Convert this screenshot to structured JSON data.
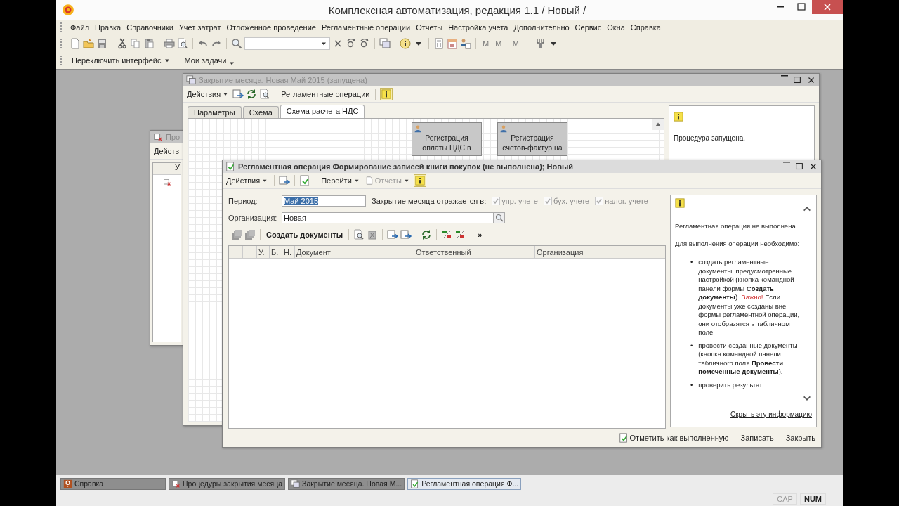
{
  "window": {
    "title": "Комплексная автоматизация, редакция 1.1 / Новый /"
  },
  "menu": [
    "Файл",
    "Правка",
    "Справочники",
    "Учет затрат",
    "Отложенное проведение",
    "Регламентные операции",
    "Отчеты",
    "Настройка учета",
    "Дополнительно",
    "Сервис",
    "Окна",
    "Справка"
  ],
  "toolbar": {
    "memory_buttons": [
      "M",
      "M+",
      "M−"
    ]
  },
  "panel_bar": [
    "Переключить интерфейс",
    "Мои задачи"
  ],
  "procedures_window": {
    "title": "Про",
    "toolbar": "Действ",
    "column": "У"
  },
  "month_close_window": {
    "title": "Закрытие месяца. Новая Май 2015 (запущена)",
    "active": false,
    "toolbar": [
      "Действия",
      "Регламентные операции"
    ],
    "tabs": [
      {
        "label": "Параметры",
        "selected": false
      },
      {
        "label": "Схема",
        "selected": false
      },
      {
        "label": "Схема расчета НДС",
        "selected": true
      }
    ],
    "nodes": [
      "Регистрация оплаты НДС в",
      "Регистрация счетов-фактур на"
    ],
    "info": "Процедура запущена."
  },
  "operation_window": {
    "title": "Регламентная операция Формирование записей книги покупок (не выполнена); Новый",
    "active": true,
    "toolbar": [
      {
        "label": "Действия",
        "disabled": false
      },
      {
        "label": "Перейти",
        "disabled": false
      },
      {
        "label": "Отчеты",
        "disabled": true
      }
    ],
    "period": {
      "label": "Период:",
      "value": "Май 2015",
      "text_selected": true
    },
    "reflect_label": "Закрытие месяца отражается в:",
    "checkboxes": [
      {
        "label": "упр. учете",
        "checked": true,
        "disabled": true
      },
      {
        "label": "бух. учете",
        "checked": true,
        "disabled": true
      },
      {
        "label": "налог. учете",
        "checked": true,
        "disabled": true
      }
    ],
    "organization": {
      "label": "Организация:",
      "value": "Новая"
    },
    "create_button": "Создать документы",
    "more": "»",
    "columns": [
      "У.",
      "Б.",
      "Н.",
      "Документ",
      "Ответственный",
      "Организация"
    ],
    "info": {
      "bullet": "•",
      "status": "Регламентная операция не выполнена.",
      "intro": "Для выполнения операции необходимо:",
      "steps": [
        {
          "text": "создать регламентные документы, предусмотренные настройкой (кнопка командной панели формы **Создать документы**).",
          "warning": "Важно!",
          "after": "Если документы уже созданы вне формы регламентной операции, они отобразятся в табличном поле"
        },
        {
          "text": "провести созданные документы (кнопка командной панели табличного поля **Провести помеченные документы**)."
        },
        {
          "text": "проверить результат"
        }
      ],
      "hide_link": "Скрыть эту информацию"
    },
    "buttons": [
      "Отметить как выполненную",
      "Записать",
      "Закрыть"
    ]
  },
  "taskbar": [
    {
      "label": "Справка",
      "selected": false
    },
    {
      "label": "Процедуры закрытия месяца",
      "selected": false
    },
    {
      "label": "Закрытие месяца. Новая М...",
      "selected": false
    },
    {
      "label": "Регламентная операция Ф...",
      "selected": true
    }
  ],
  "status_bar": [
    {
      "label": "CAP",
      "on": false
    },
    {
      "label": "NUM",
      "on": true
    }
  ]
}
